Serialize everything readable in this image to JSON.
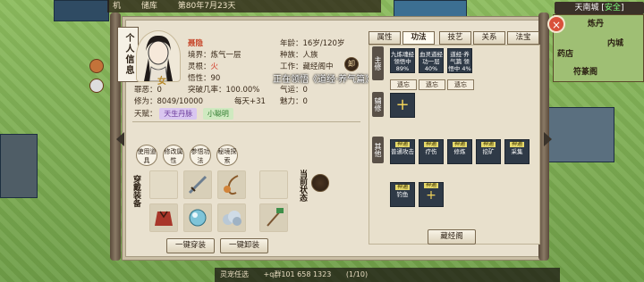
{
  "hud": {
    "left_label": "机",
    "date": "第80年7月23天",
    "location_label": "储库"
  },
  "city": {
    "name": "天南城",
    "status": "安全"
  },
  "minimap": {
    "labels": [
      "炼丹",
      "药店",
      "符篆阁",
      "内城"
    ]
  },
  "bottom": {
    "text1": "灵宠任选",
    "text2": "+q群101 658 1323",
    "counter": "(1/10)"
  },
  "panel": {
    "title": "个人信息",
    "character": {
      "name": "聂隐",
      "realm_label": "境界：",
      "realm": "炼气一层",
      "root_label": "灵根：",
      "root": "火",
      "aptitude_label": "悟性：",
      "aptitude": "90",
      "age_label": "年龄：",
      "age": "16岁/120岁",
      "race_label": "种族：",
      "race": "人族",
      "work_label": "工作：",
      "work": "藏经阁中",
      "work_badge": "卸",
      "evil_label": "罪恶：",
      "evil": "0",
      "breakthrough_label": "突破几率：",
      "breakthrough": "100.00%",
      "qiyun_label": "气运：",
      "qiyun": "0",
      "cultivation_label": "修为：",
      "cultivation": "8049/10000",
      "rate_label": "每天+",
      "rate": "31",
      "charm_label": "魅力：",
      "charm": "0",
      "talent_label": "天赋：",
      "talents": [
        "天生丹脉",
        "小聪明"
      ],
      "gender_mark": "女"
    },
    "round_buttons": [
      "使用道具",
      "修改属性",
      "参悟功法",
      "秘境探索"
    ],
    "equip_label": "穿戴装备",
    "status_label": "当前状态",
    "equip_all": "一键穿装",
    "unequip_all": "一键卸装",
    "cultivating_text": "正在领悟《道经·养气篇》",
    "tabs": [
      "属性",
      "功法",
      "技艺",
      "关系",
      "法宝"
    ],
    "active_tab": 1,
    "skill_sections": {
      "main_label": "主修",
      "assist_label": "辅修",
      "other_label": "其他"
    },
    "main_cards": [
      {
        "text": "九炼魂经 领悟中 89%"
      },
      {
        "text": "血灵道经 功一层 40%"
      },
      {
        "text": "道经·养气篇 领悟中 4%"
      }
    ],
    "forget_label": "遗忘",
    "other_badge": "神通",
    "other_cards": [
      "普通攻击",
      "疗伤",
      "修炼",
      "挖矿",
      "采集",
      "钓鱼",
      ""
    ],
    "scripture_hall": "藏经阁"
  }
}
